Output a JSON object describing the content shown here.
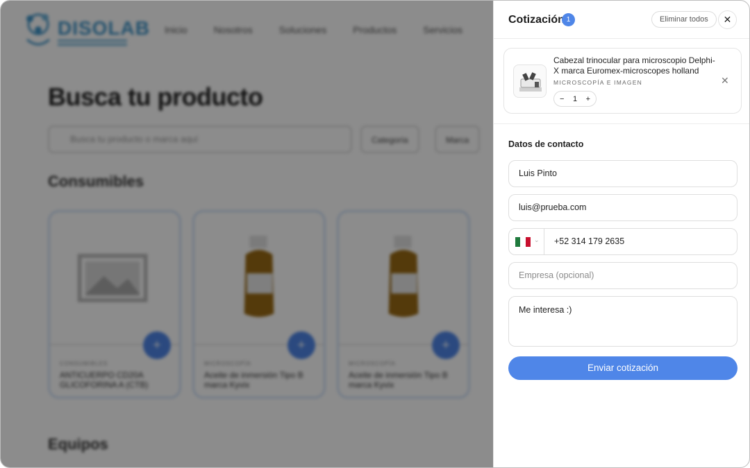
{
  "background_page": {
    "logo_text": "DISOLAB",
    "nav": [
      "Inicio",
      "Nosotros",
      "Soluciones",
      "Productos",
      "Servicios"
    ],
    "title": "Busca tu producto",
    "search_placeholder": "Busca tu producto o marca aquí",
    "filters": [
      "Categoría",
      "Marca"
    ],
    "sections": [
      "Consumibles",
      "Equipos"
    ],
    "cards": [
      {
        "category": "CONSUMIBLES",
        "name": "ANTICUERPO CD20A GLICOFORINA A (CTB)"
      },
      {
        "category": "MICROSCOPÍA",
        "name": "Aceite de inmersión Tipo B marca Kyvix"
      },
      {
        "category": "MICROSCOPÍA",
        "name": "Aceite de inmersión Tipo B marca Kyvix"
      }
    ]
  },
  "drawer": {
    "title": "Cotización",
    "count": "1",
    "clear_label": "Eliminar todos",
    "close_icon": "close-icon",
    "item": {
      "name": "Cabezal trinocular para microscopio Delphi-X marca Euromex-microscopes holland",
      "category": "MICROSCOPÍA E IMAGEN",
      "quantity": "1",
      "minus": "−",
      "plus": "+",
      "remove": "✕"
    },
    "contact_title": "Datos de contacto",
    "fields": {
      "name": "Luis Pinto",
      "email": "luis@prueba.com",
      "phone": "+52 314 179 2635",
      "company_placeholder": "Empresa (opcional)",
      "message": "Me interesa :)"
    },
    "submit_label": "Enviar cotización",
    "colors": {
      "accent": "#4f86e8",
      "flag_green": "#1f7a3d",
      "flag_red": "#c8102e"
    }
  }
}
